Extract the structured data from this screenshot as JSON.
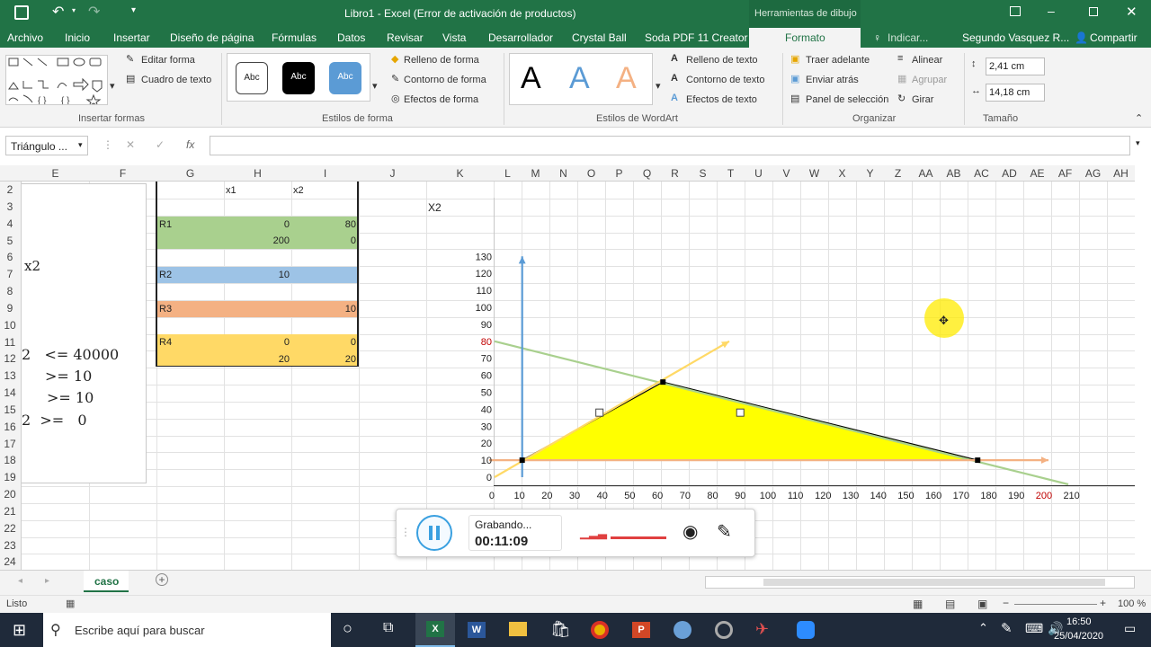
{
  "window": {
    "title": "Libro1 - Excel (Error de activación de productos)",
    "drawing_tools": "Herramientas de dibujo"
  },
  "tabs": [
    "Archivo",
    "Inicio",
    "Insertar",
    "Diseño de página",
    "Fórmulas",
    "Datos",
    "Revisar",
    "Vista",
    "Desarrollador",
    "Crystal Ball",
    "Soda PDF 11 Creator",
    "Formato"
  ],
  "tell_me": "Indicar...",
  "user": "Segundo Vasquez R...",
  "share": "Compartir",
  "ribbon": {
    "groups": [
      "Insertar formas",
      "Estilos de forma",
      "Estilos de WordArt",
      "Organizar",
      "Tamaño"
    ],
    "edit_shape": "Editar forma",
    "text_box": "Cuadro de texto",
    "shape_fill": "Relleno de forma",
    "shape_outline": "Contorno de forma",
    "shape_effects": "Efectos de forma",
    "style_samples": [
      "Abc",
      "Abc",
      "Abc"
    ],
    "wordart_samples": [
      "A",
      "A",
      "A"
    ],
    "text_fill": "Relleno de texto",
    "text_outline": "Contorno de texto",
    "text_effects": "Efectos de texto",
    "bring_forward": "Traer adelante",
    "send_backward": "Enviar atrás",
    "selection_pane": "Panel de selección",
    "align": "Alinear",
    "group": "Agrupar",
    "rotate": "Girar",
    "height": "2,41 cm",
    "width": "14,18 cm"
  },
  "formula_bar": {
    "name_box": "Triángulo ...",
    "formula": ""
  },
  "columns": [
    "E",
    "F",
    "G",
    "H",
    "I",
    "J",
    "K",
    "L",
    "M",
    "N",
    "O",
    "P",
    "Q",
    "R",
    "S",
    "T",
    "U",
    "V",
    "W",
    "X",
    "Y",
    "Z",
    "AA",
    "AB",
    "AC",
    "AD",
    "AE",
    "AF",
    "AG",
    "AH"
  ],
  "rows": [
    "2",
    "3",
    "4",
    "5",
    "6",
    "7",
    "8",
    "9",
    "10",
    "11",
    "12",
    "13",
    "14",
    "15",
    "16",
    "17",
    "18",
    "19",
    "20",
    "21",
    "22",
    "23",
    "24"
  ],
  "left_box": {
    "x2_label": "x2",
    "lines": [
      "2   <= 40000",
      ">= 10",
      ">= 10",
      "2  >=   0"
    ]
  },
  "table": {
    "headers": [
      "x1",
      "x2"
    ],
    "r1": {
      "label": "R1",
      "a1": "0",
      "a2": "80",
      "b1": "200",
      "b2": "0"
    },
    "r2": {
      "label": "R2",
      "a1": "10"
    },
    "r3": {
      "label": "R3",
      "a2": "10"
    },
    "r4": {
      "label": "R4",
      "a1": "0",
      "a2": "0",
      "b1": "20",
      "b2": "20"
    }
  },
  "chart_data": {
    "type": "line",
    "title": "",
    "ylabel": "X2",
    "xlim": [
      0,
      210
    ],
    "ylim": [
      0,
      130
    ],
    "x_ticks": [
      0,
      10,
      20,
      30,
      40,
      50,
      60,
      70,
      80,
      90,
      100,
      110,
      120,
      130,
      140,
      150,
      160,
      170,
      180,
      190,
      200,
      210
    ],
    "y_ticks": [
      0,
      10,
      20,
      30,
      40,
      50,
      60,
      70,
      80,
      90,
      100,
      110,
      120,
      130
    ],
    "highlight": {
      "x": "200",
      "y": "80",
      "color": "#c00000"
    },
    "series": [
      {
        "values": [
          [
            0,
            80
          ],
          [
            200,
            0
          ]
        ],
        "color": "#a9d08e"
      },
      {
        "values": [
          [
            10,
            0
          ],
          [
            10,
            130
          ]
        ],
        "color": "#5b9bd5"
      },
      {
        "values": [
          [
            0,
            10
          ],
          [
            200,
            10
          ]
        ],
        "color": "#f4b183"
      },
      {
        "values": [
          [
            0,
            0
          ],
          [
            85,
            80
          ]
        ],
        "color": "#ffd966"
      }
    ],
    "feasible_region": [
      [
        10,
        10
      ],
      [
        61,
        56
      ],
      [
        175,
        10
      ]
    ],
    "region_color": "#ffff00"
  },
  "recorder": {
    "status": "Grabando...",
    "time": "00:11:09"
  },
  "sheet": {
    "name": "caso"
  },
  "status": {
    "ready": "Listo",
    "zoom": "100 %"
  },
  "taskbar": {
    "search": "Escribe aquí para buscar",
    "time": "16:50",
    "date": "25/04/2020"
  }
}
